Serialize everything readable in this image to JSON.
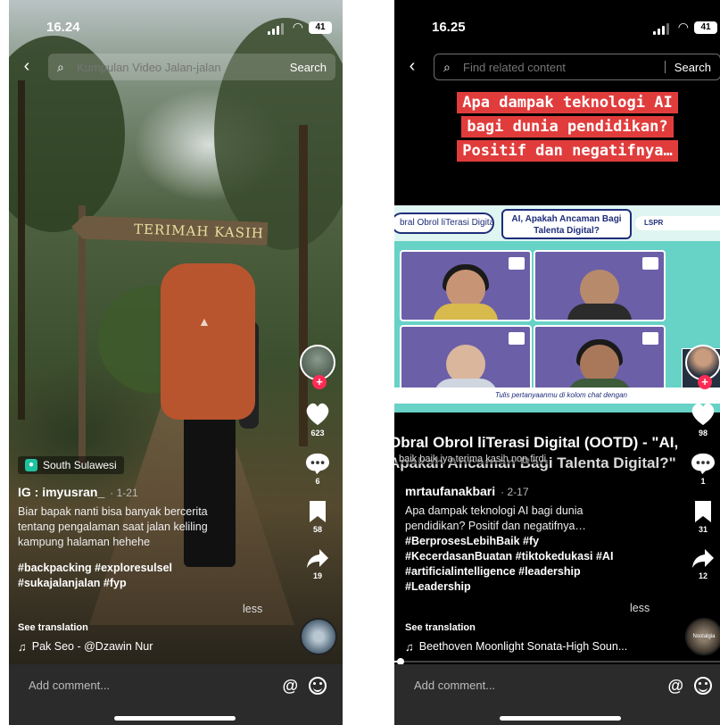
{
  "left": {
    "status": {
      "time": "16.24",
      "battery": "41"
    },
    "search": {
      "placeholder": "Kumpulan Video Jalan-jalan",
      "button": "Search"
    },
    "scene": {
      "sign_text": "TERIMAH KASIH"
    },
    "rail": {
      "likes": "623",
      "comments": "6",
      "saves": "58",
      "shares": "19"
    },
    "caption": {
      "location": "South Sulawesi",
      "author": "IG : imyusran_",
      "date": "· 1-21",
      "description": "Biar bapak nanti bisa banyak bercerita\ntentang pengalaman saat jalan keliling\nkampung halaman hehehe",
      "hashtags": "#backpacking #exploresulsel\n#sukajalanjalan #fyp",
      "less": "less",
      "see_translation": "See translation",
      "music": "Pak Seo - @Dzawin Nur"
    },
    "comment": {
      "placeholder": "Add comment..."
    }
  },
  "right": {
    "status": {
      "time": "16.25",
      "battery": "41"
    },
    "search": {
      "placeholder": "Find related content",
      "button": "Search"
    },
    "headline": "Apa dampak teknologi AI bagi dunia pendidikan? Positif dan negatifnya…",
    "video": {
      "left_pill": "bral Obrol liTerasi Digital (OOTD)",
      "center_pill": "AI, Apakah Ancaman Bagi Talenta Digital?",
      "logos": "LSPR",
      "footer": "Tulis pertanyaanmu di kolom chat dengan"
    },
    "caption_overlay": {
      "line1": "Obral Obrol liTerasi Digital (OOTD) - \"AI,",
      "line2": "Apakah Ancaman Bagi Talenta Digital?\"",
      "sub": "baik baik iya terima kasih non firdi"
    },
    "rail": {
      "likes": "98",
      "comments": "1",
      "saves": "31",
      "shares": "12",
      "disc_label": "Nostalgia"
    },
    "caption": {
      "author": "mrtaufanakbari",
      "date": "· 2-17",
      "description": "Apa dampak teknologi AI bagi dunia\npendidikan? Positif dan negatifnya…",
      "hashtags": "#BerprosesLebihBaik #fy\n#KecerdasanBuatan #tiktokedukasi #AI\n#artificialintelligence #leadership\n#Leadership",
      "less": "less",
      "see_translation": "See translation",
      "music": "Beethoven Moonlight Sonata-High Soun..."
    },
    "progress": 0.02,
    "comment": {
      "placeholder": "Add comment..."
    }
  },
  "icons": {
    "back": "chevron-left-icon",
    "search": "search-icon",
    "heart": "heart-icon",
    "comment": "comment-bubble-icon",
    "save": "bookmark-icon",
    "share": "share-arrow-icon",
    "music": "music-note-icon",
    "mention": "at-sign-icon",
    "emoji": "emoji-icon"
  },
  "colors": {
    "accent": "#fe2c55",
    "headline_bg": "#e13c3c",
    "location": "#1ec2a0"
  }
}
